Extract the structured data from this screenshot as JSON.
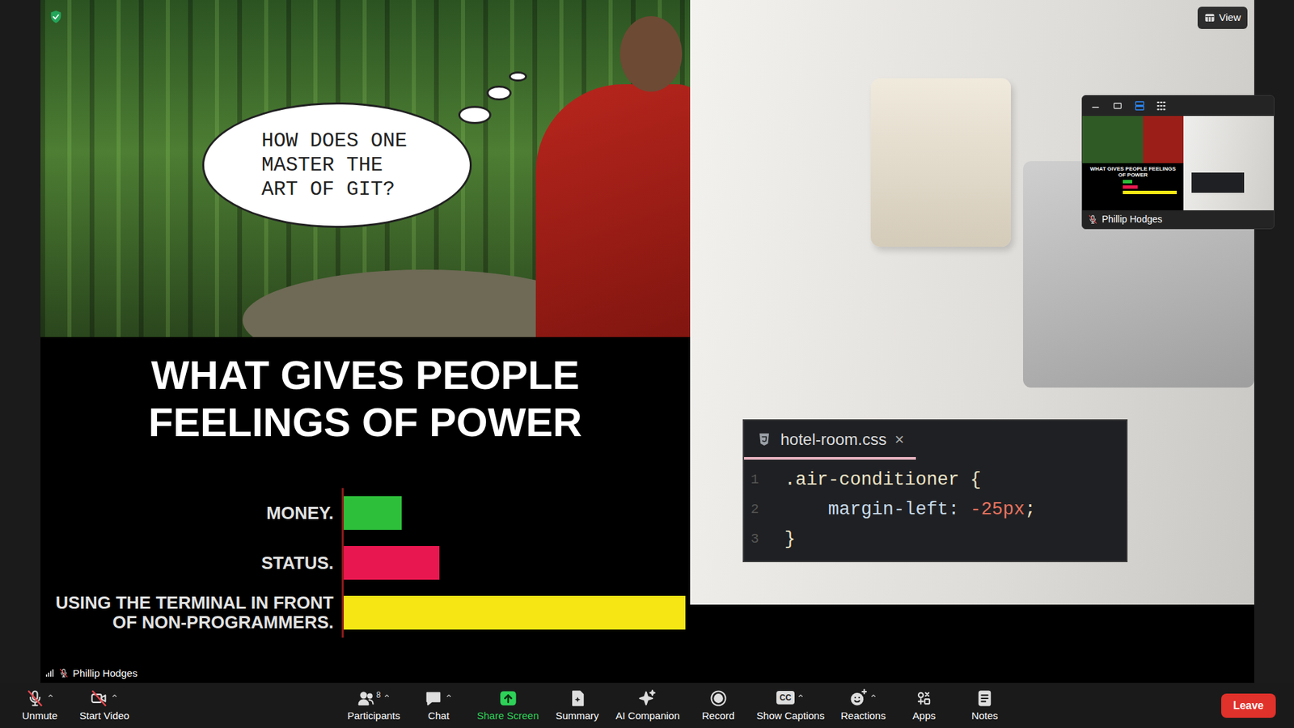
{
  "meeting": {
    "secure": true,
    "view_button": "View"
  },
  "participant": {
    "name": "Phillip Hodges",
    "muted": true
  },
  "share": {
    "bubble": "HOW DOES ONE MASTER THE ART OF GIT?",
    "chart": {
      "title": "WHAT GIVES PEOPLE FEELINGS OF POWER",
      "bars": [
        {
          "label": "MONEY.",
          "value": 17,
          "color": "#2dbf3a"
        },
        {
          "label": "STATUS.",
          "value": 28,
          "color": "#e8174f"
        },
        {
          "label": "USING THE TERMINAL IN FRONT OF NON-PROGRAMMERS.",
          "value": 100,
          "color": "#f5e614"
        }
      ]
    },
    "editor": {
      "tab": "hotel-room.css",
      "close": "×",
      "lines": [
        {
          "number": "1",
          "tokens": [
            {
              "text": ".air-conditioner {",
              "color": "#ece3c6"
            }
          ]
        },
        {
          "number": "2",
          "tokens": [
            {
              "text": "    margin-left: ",
              "color": "#c9dbe8"
            },
            {
              "text": "-25px",
              "color": "#e9735f"
            },
            {
              "text": ";",
              "color": "#ece3c6"
            }
          ]
        },
        {
          "number": "3",
          "tokens": [
            {
              "text": "}",
              "color": "#ece3c6"
            }
          ]
        }
      ]
    }
  },
  "thumbnail": {
    "controls": [
      {
        "kind": "minimize",
        "selected": false
      },
      {
        "kind": "single",
        "selected": false
      },
      {
        "kind": "stacked",
        "selected": true
      },
      {
        "kind": "grid",
        "selected": false
      }
    ]
  },
  "toolbar": {
    "left": [
      {
        "label": "Unmute",
        "kind": "mic",
        "off": true,
        "menu": true
      },
      {
        "label": "Start Video",
        "kind": "video",
        "off": true,
        "menu": true
      }
    ],
    "center": [
      {
        "label": "Participants",
        "kind": "participants",
        "count": "8",
        "menu": true,
        "color": "#ffffff"
      },
      {
        "label": "Chat",
        "kind": "chat",
        "menu": true,
        "color": "#ffffff"
      },
      {
        "label": "Share Screen",
        "kind": "share",
        "menu": false,
        "color": "#2ed158"
      },
      {
        "label": "Summary",
        "kind": "summary",
        "menu": false,
        "color": "#ffffff"
      },
      {
        "label": "AI Companion",
        "kind": "ai",
        "menu": false,
        "color": "#ffffff"
      },
      {
        "label": "Record",
        "kind": "record",
        "menu": false,
        "color": "#ffffff"
      },
      {
        "label": "Show Captions",
        "kind": "captions",
        "badge": "CC",
        "menu": true,
        "color": "#ffffff"
      },
      {
        "label": "Reactions",
        "kind": "reactions",
        "menu": true,
        "color": "#ffffff"
      },
      {
        "label": "Apps",
        "kind": "apps",
        "menu": false,
        "color": "#ffffff"
      },
      {
        "label": "Notes",
        "kind": "notes",
        "menu": false,
        "color": "#ffffff"
      }
    ],
    "leave": "Leave"
  }
}
